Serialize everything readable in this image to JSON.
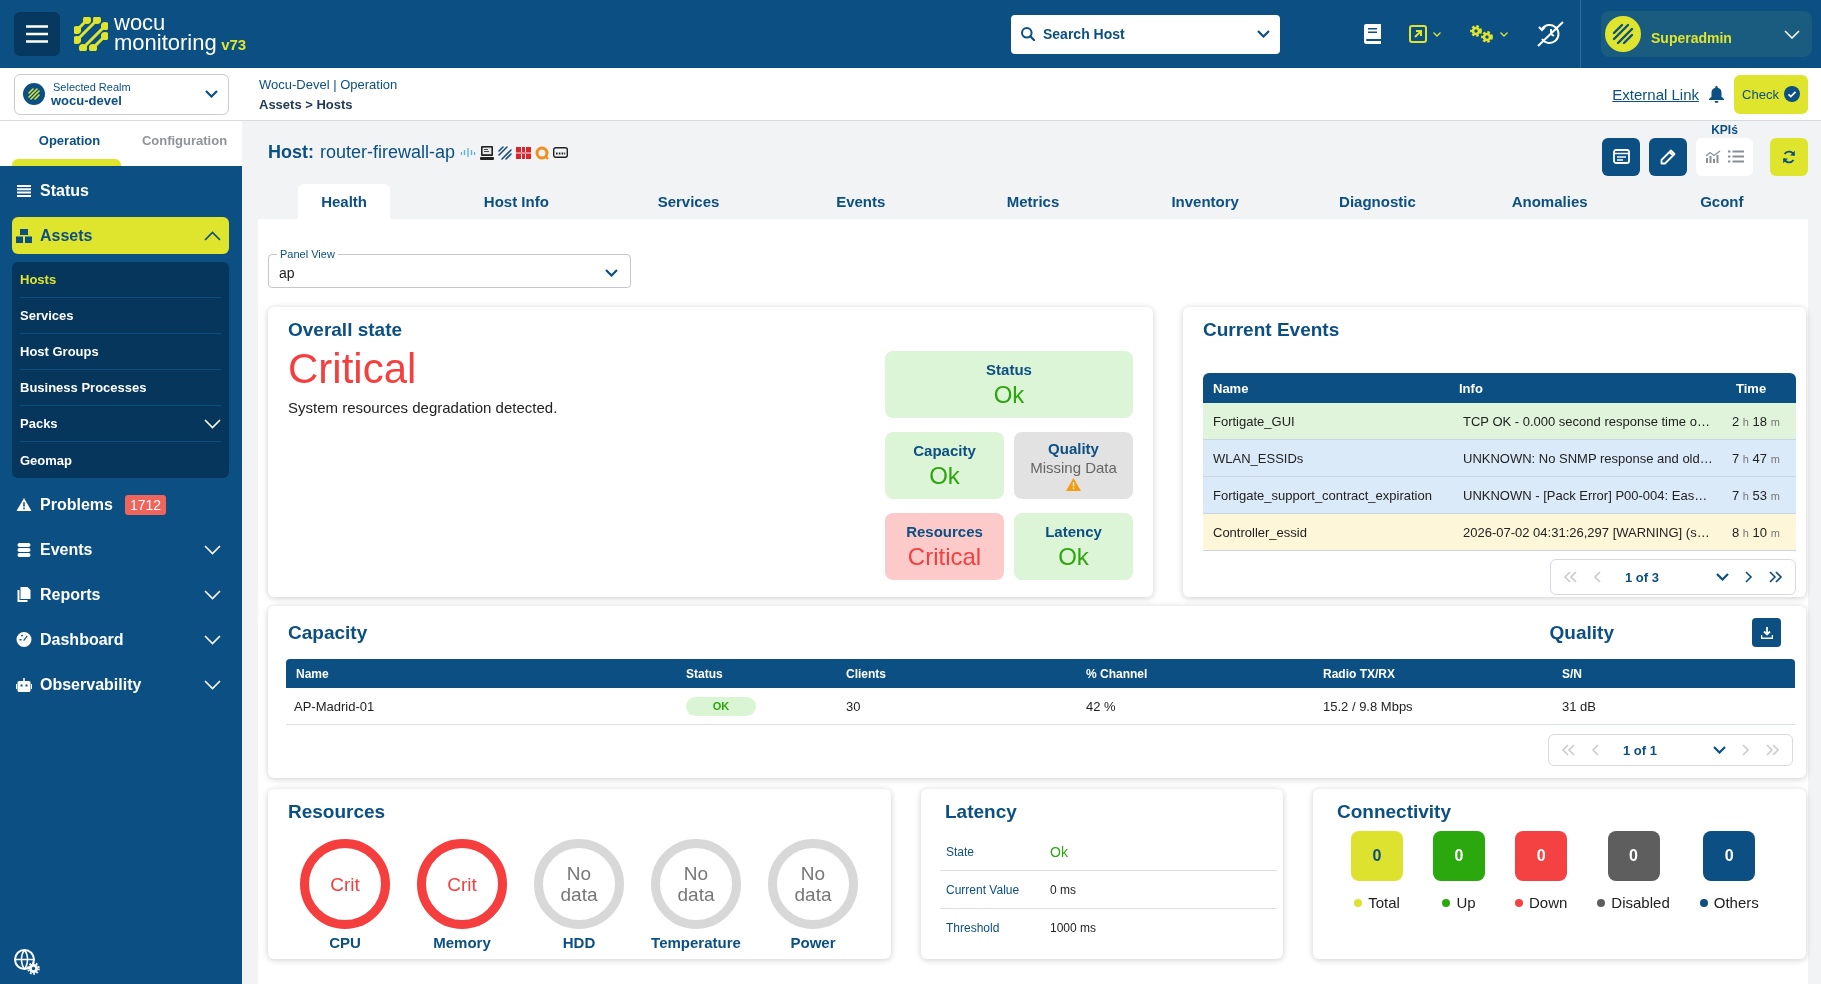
{
  "topbar": {
    "logo": {
      "line1": "wocu",
      "line2": "monitoring",
      "version": "v73"
    },
    "search": {
      "placeholder": "Search Host"
    },
    "user": {
      "name": "Superadmin"
    }
  },
  "realm": {
    "label": "Selected Realm",
    "value": "wocu-devel"
  },
  "breadcrumb": {
    "context": "Wocu-Devel | Operation",
    "path": "Assets > Hosts"
  },
  "header_actions": {
    "link": "External Link",
    "check": "Check"
  },
  "sidebar": {
    "tabs": [
      {
        "label": "Operation",
        "selected": true
      },
      {
        "label": "Configuration",
        "selected": false
      }
    ],
    "items": [
      {
        "label": "Status",
        "kind": "link",
        "selected": false
      },
      {
        "label": "Assets",
        "kind": "group",
        "selected": true,
        "expanded": true,
        "children": [
          {
            "label": "Hosts",
            "kind": "link",
            "selected": true
          },
          {
            "label": "Services",
            "kind": "link",
            "selected": false
          },
          {
            "label": "Host Groups",
            "kind": "link",
            "selected": false
          },
          {
            "label": "Business Processes",
            "kind": "link",
            "selected": false
          },
          {
            "label": "Packs",
            "kind": "group",
            "selected": false,
            "expanded": false
          },
          {
            "label": "Geomap",
            "kind": "link",
            "selected": false
          }
        ]
      },
      {
        "label": "Problems",
        "kind": "link",
        "selected": false,
        "badge": "1712"
      },
      {
        "label": "Events",
        "kind": "group",
        "selected": false,
        "expanded": false
      },
      {
        "label": "Reports",
        "kind": "group",
        "selected": false,
        "expanded": false
      },
      {
        "label": "Dashboard",
        "kind": "group",
        "selected": false,
        "expanded": false
      },
      {
        "label": "Observability",
        "kind": "group",
        "selected": false,
        "expanded": false
      }
    ]
  },
  "host": {
    "label": "Host:",
    "name": "router-firewall-ap",
    "kpis_label": "KPIś"
  },
  "tabs": [
    {
      "label": "Health",
      "selected": true
    },
    {
      "label": "Host Info",
      "selected": false
    },
    {
      "label": "Services",
      "selected": false
    },
    {
      "label": "Events",
      "selected": false
    },
    {
      "label": "Metrics",
      "selected": false
    },
    {
      "label": "Inventory",
      "selected": false
    },
    {
      "label": "Diagnostic",
      "selected": false
    },
    {
      "label": "Anomalies",
      "selected": false
    },
    {
      "label": "Gconf",
      "selected": false
    }
  ],
  "panel_view": {
    "label": "Panel View",
    "value": "ap"
  },
  "overall_state": {
    "title": "Overall state",
    "state": "Critical",
    "kind": "critical",
    "description": "System resources degradation detected.",
    "tiles": [
      {
        "label": "Status",
        "value": "Ok",
        "kind": "ok"
      },
      {
        "label": "Capacity",
        "value": "Ok",
        "kind": "ok"
      },
      {
        "label": "Quality",
        "value": "Missing Data",
        "kind": "missing"
      },
      {
        "label": "Resources",
        "value": "Critical",
        "kind": "critical"
      },
      {
        "label": "Latency",
        "value": "Ok",
        "kind": "ok"
      }
    ]
  },
  "current_events": {
    "title": "Current Events",
    "columns": [
      "Name",
      "Info",
      "Time"
    ],
    "rows": [
      {
        "name": "Fortigate_GUI",
        "info": "TCP OK - 0.000 second response time o…",
        "time": [
          {
            "value": "2",
            "unit": "h"
          },
          {
            "value": "18",
            "unit": "m"
          }
        ],
        "kind": "ok"
      },
      {
        "name": "WLAN_ESSIDs",
        "info": "UNKNOWN: No SNMP response and old…",
        "time": [
          {
            "value": "7",
            "unit": "h"
          },
          {
            "value": "47",
            "unit": "m"
          }
        ],
        "kind": "unknown"
      },
      {
        "name": "Fortigate_support_contract_expiration",
        "info": "UNKNOWN - [Pack Error] P00-004: Eas…",
        "time": [
          {
            "value": "7",
            "unit": "h"
          },
          {
            "value": "53",
            "unit": "m"
          }
        ],
        "kind": "unknown"
      },
      {
        "name": "Controller_essid",
        "info": "2026-07-02 04:31:26,297 [WARNING] (s…",
        "time": [
          {
            "value": "8",
            "unit": "h"
          },
          {
            "value": "10",
            "unit": "m"
          }
        ],
        "kind": "warning"
      }
    ],
    "pagination": {
      "label": "1 of 3",
      "prev_enabled": false,
      "next_enabled": true
    }
  },
  "capacity": {
    "title": "Capacity",
    "quality_title": "Quality",
    "columns": [
      "Name",
      "Status",
      "Clients",
      "% Channel",
      "Radio TX/RX",
      "S/N"
    ],
    "rows": [
      {
        "name": "AP-Madrid-01",
        "status": "OK",
        "kind": "ok",
        "clients": "30",
        "channel": "42 %",
        "radio": "15.2 / 9.8 Mbps",
        "sn": "31 dB"
      }
    ],
    "pagination": {
      "label": "1 of 1",
      "prev_enabled": false,
      "next_enabled": false
    }
  },
  "resources": {
    "title": "Resources",
    "gauges": [
      {
        "label": "CPU",
        "value": "Crit",
        "kind": "critical"
      },
      {
        "label": "Memory",
        "value": "Crit",
        "kind": "critical"
      },
      {
        "label": "HDD",
        "value": "No data",
        "kind": "nodata"
      },
      {
        "label": "Temperature",
        "value": "No data",
        "kind": "nodata"
      },
      {
        "label": "Power",
        "value": "No data",
        "kind": "nodata"
      }
    ]
  },
  "latency": {
    "title": "Latency",
    "rows": [
      {
        "label": "State",
        "value": "Ok",
        "kind": "ok"
      },
      {
        "label": "Current Value",
        "value": "0 ms",
        "kind": "plain"
      },
      {
        "label": "Threshold",
        "value": "1000 ms",
        "kind": "plain"
      }
    ]
  },
  "connectivity": {
    "title": "Connectivity",
    "counters": [
      {
        "label": "Total",
        "count": "0",
        "color": "#dde22e"
      },
      {
        "label": "Up",
        "count": "0",
        "color": "#2aa80e"
      },
      {
        "label": "Down",
        "count": "0",
        "color": "#f44242"
      },
      {
        "label": "Disabled",
        "count": "0",
        "color": "#5e5e5e"
      },
      {
        "label": "Others",
        "count": "0",
        "color": "#0b4f83"
      }
    ]
  }
}
